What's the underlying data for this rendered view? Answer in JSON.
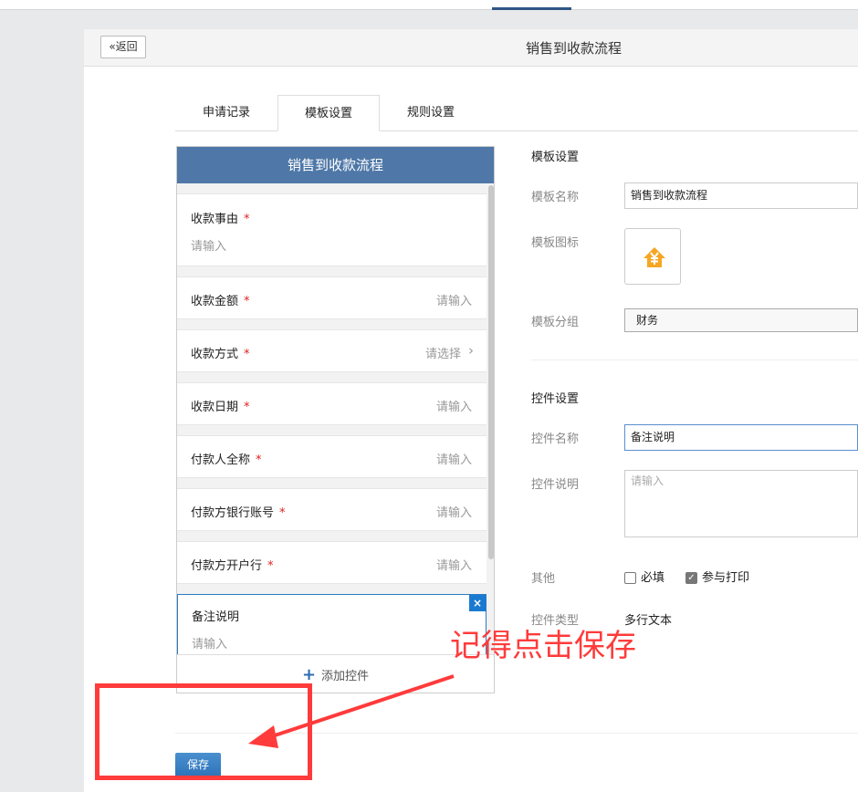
{
  "header": {
    "back_label": "«返回",
    "title": "销售到收款流程"
  },
  "tabs": [
    {
      "label": "申请记录"
    },
    {
      "label": "模板设置",
      "active": true
    },
    {
      "label": "规则设置"
    }
  ],
  "form_preview": {
    "title": "销售到收款流程",
    "fields": [
      {
        "label": "收款事由",
        "required": true,
        "placeholder": "请输入"
      },
      {
        "label": "收款金额",
        "required": true,
        "placeholder": "请输入"
      },
      {
        "label": "收款方式",
        "required": true,
        "placeholder": "请选择"
      },
      {
        "label": "收款日期",
        "required": true,
        "placeholder": "请输入"
      },
      {
        "label": "付款人全称",
        "required": true,
        "placeholder": "请输入"
      },
      {
        "label": "付款方银行账号",
        "required": true,
        "placeholder": "请输入"
      },
      {
        "label": "付款方开户行",
        "required": true,
        "placeholder": "请输入"
      },
      {
        "label": "备注说明",
        "required": false,
        "placeholder": "请输入",
        "selected": true
      }
    ],
    "required_mark": "*",
    "delete_label": "×",
    "add_label": "添加控件",
    "add_icon": "+"
  },
  "template_settings": {
    "heading": "模板设置",
    "name_label": "模板名称",
    "name_value": "销售到收款流程",
    "icon_label": "模板图标",
    "icon": "yen-house-icon",
    "icon_color": "#f5a623",
    "group_label": "模板分组",
    "group_value": "财务"
  },
  "control_settings": {
    "heading": "控件设置",
    "name_label": "控件名称",
    "name_value": "备注说明",
    "desc_label": "控件说明",
    "desc_placeholder": "请输入",
    "other_label": "其他",
    "required_label": "必填",
    "required_checked": false,
    "print_label": "参与打印",
    "print_checked": true,
    "type_label": "控件类型",
    "type_value": "多行文本"
  },
  "save_label": "保存",
  "annotation": {
    "text": "记得点击保存",
    "color": "#ff3b3b"
  }
}
